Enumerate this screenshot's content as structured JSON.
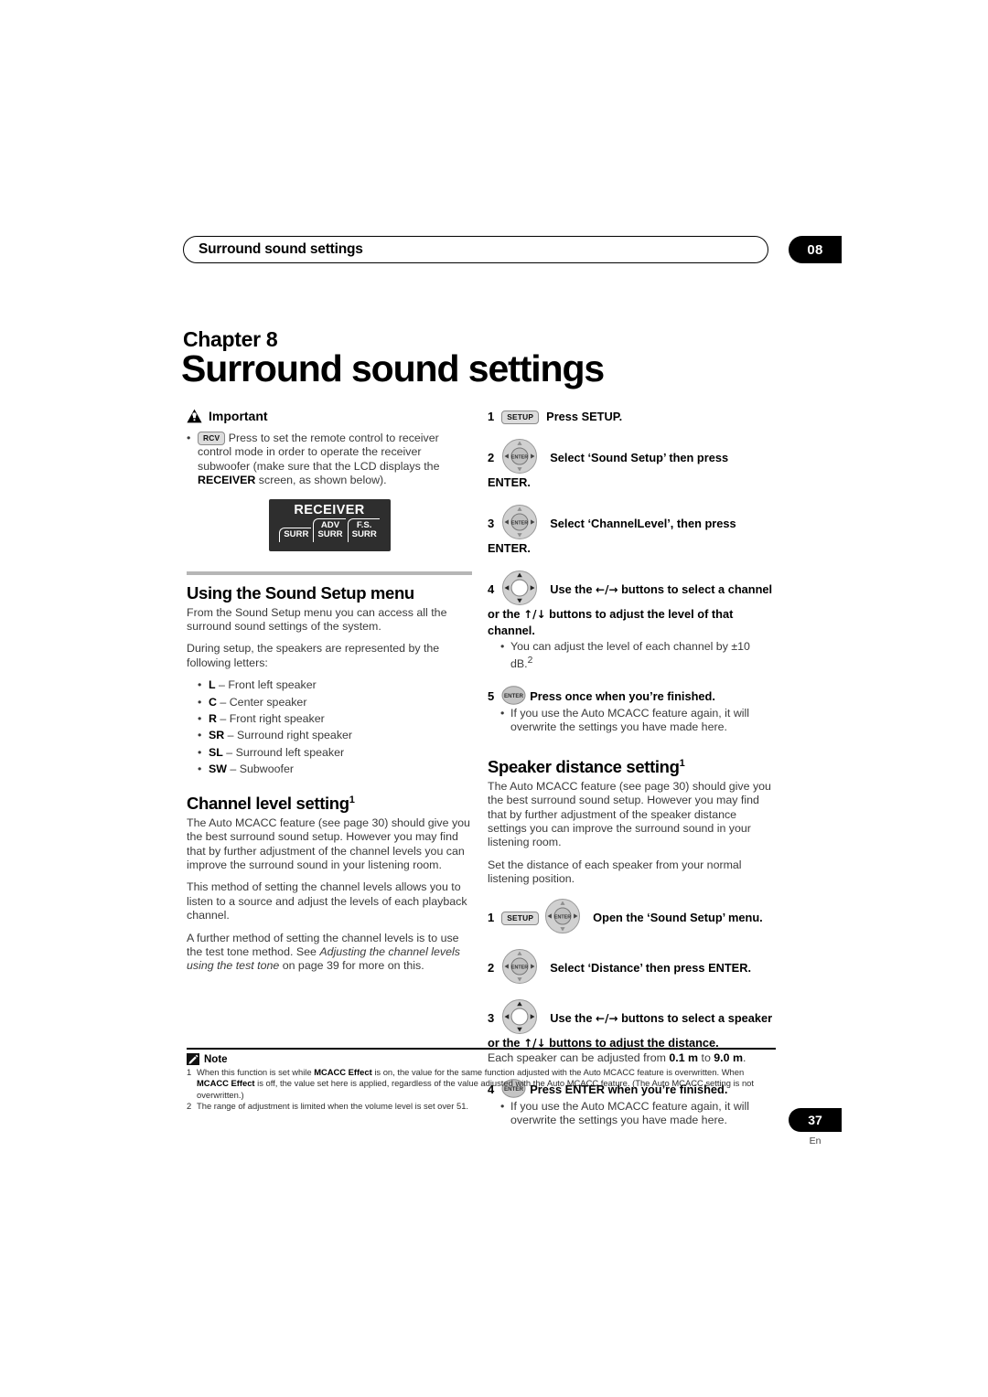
{
  "running_head": {
    "title": "Surround sound settings",
    "chapter_tab": "08"
  },
  "chapter": {
    "label": "Chapter 8",
    "title": "Surround sound settings"
  },
  "left_column": {
    "important": {
      "icon": "warning-triangle-icon",
      "label": "Important",
      "bullet_marker": "•",
      "key": "RCV",
      "text_before_bold": "Press to set the remote control to receiver control mode in order to operate the receiver subwoofer (make sure that the LCD displays the ",
      "bold_word": "RECEIVER",
      "text_after_bold": " screen, as shown below)."
    },
    "lcd": {
      "title": "RECEIVER",
      "tabs": [
        "SURR",
        "ADV\nSURR",
        "F.S.\nSURR"
      ]
    },
    "section_sound_setup": {
      "heading": "Using the Sound Setup menu",
      "paragraphs": [
        "From the Sound Setup menu you can access all the surround sound settings of the system.",
        "During setup, the speakers are represented by the following letters:"
      ],
      "speaker_letters": [
        {
          "abbr": "L",
          "desc": " – Front left speaker"
        },
        {
          "abbr": "C",
          "desc": " – Center speaker"
        },
        {
          "abbr": "R",
          "desc": " – Front right speaker"
        },
        {
          "abbr": "SR",
          "desc": " – Surround right speaker"
        },
        {
          "abbr": "SL",
          "desc": " – Surround left speaker"
        },
        {
          "abbr": "SW",
          "desc": " – Subwoofer"
        }
      ]
    },
    "section_channel_level": {
      "heading": "Channel level setting",
      "heading_sup": "1",
      "paragraphs": [
        "The Auto MCACC feature (see page 30) should give you the best surround sound setup. However you may find that by further adjustment of the channel levels you can improve the surround sound in your listening room.",
        "This method of setting the channel levels allows you to listen to a source and adjust the levels of each playback channel."
      ],
      "last_paragraph_part1": "A further method of setting the channel levels is to use the test tone method. See ",
      "last_paragraph_italic": "Adjusting the channel levels using the test tone",
      "last_paragraph_part2": " on page 39 for more on this."
    }
  },
  "right_column": {
    "channel_level_steps": [
      {
        "num": "1",
        "icon": "setup-key-icon",
        "key": "SETUP",
        "text": "Press SETUP."
      },
      {
        "num": "2",
        "icon": "dpad-enter-icon",
        "text": "Select ‘Sound Setup’ then press ENTER."
      },
      {
        "num": "3",
        "icon": "dpad-enter-icon",
        "text": "Select ‘ChannelLevel’, then press ENTER."
      },
      {
        "num": "4",
        "icon": "dpad-icon",
        "text_a": "Use the ",
        "arrows_lr": "←/→",
        "text_b": " buttons to select a channel or the ",
        "arrows_ud": "↑/↓",
        "text_c": " buttons to adjust the level of that channel.",
        "sub_bullet": "You can adjust the level of each channel by ±10 dB.",
        "sub_bullet_sup": "2"
      },
      {
        "num": "5",
        "icon": "enter-key-icon",
        "text": "Press once when you’re finished.",
        "sub_bullet": "If you use the Auto MCACC feature again, it will overwrite the settings you have made here."
      }
    ],
    "section_speaker_distance": {
      "heading": "Speaker distance setting",
      "heading_sup": "1",
      "paragraphs": [
        "The Auto MCACC feature (see page 30) should give you the best surround sound setup. However you may find that by further adjustment of the speaker distance settings you can improve the surround sound in your listening room.",
        "Set the distance of each speaker from your normal listening position."
      ]
    },
    "distance_steps": [
      {
        "num": "1",
        "icon": "setup-key-icon",
        "key": "SETUP",
        "icon2": "dpad-enter-icon",
        "text": "Open the ‘Sound Setup’ menu."
      },
      {
        "num": "2",
        "icon": "dpad-enter-icon",
        "text": "Select ‘Distance’ then press ENTER."
      },
      {
        "num": "3",
        "icon": "dpad-icon",
        "text_a": "Use the ",
        "arrows_lr": "←/→",
        "text_b": " buttons to select a speaker or the ",
        "arrows_ud": "↑/↓",
        "text_c": " buttons to adjust the distance.",
        "note_a": "Each speaker can be adjusted from ",
        "note_bold1": "0.1 m",
        "note_b": " to ",
        "note_bold2": "9.0 m",
        "note_c": "."
      },
      {
        "num": "4",
        "icon": "enter-key-icon",
        "text": "Press ENTER when you’re finished.",
        "sub_bullet": "If you use the Auto MCACC feature again, it will overwrite the settings you have made here."
      }
    ]
  },
  "notes": {
    "icon": "pencil-note-icon",
    "label": "Note",
    "items": [
      {
        "num": "1",
        "part1": "When this function is set while ",
        "bold1": "MCACC Effect",
        "part2": " is on, the value for the same function adjusted with the Auto MCACC feature is overwritten. When ",
        "bold2": "MCACC Effect",
        "part3": " is off, the value set here is applied, regardless of the value adjusted with the Auto MCACC feature. (The Auto MCACC setting is not overwritten.)"
      },
      {
        "num": "2",
        "part1": "The range of adjustment is limited when the volume level is set over 51.",
        "bold1": "",
        "part2": "",
        "bold2": "",
        "part3": ""
      }
    ]
  },
  "folio": {
    "page_number": "37",
    "language": "En"
  }
}
